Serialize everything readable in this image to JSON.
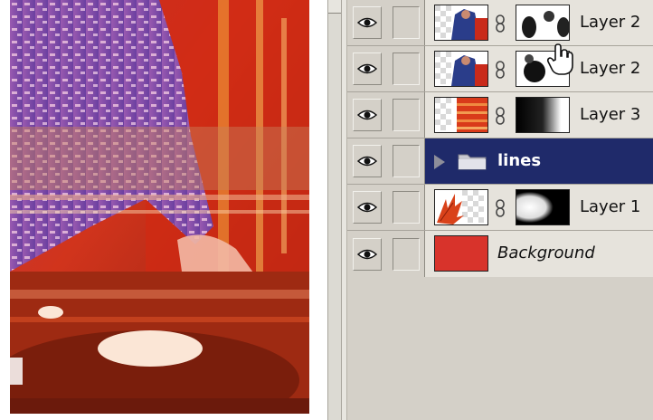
{
  "layers_panel": {
    "rows": [
      {
        "type": "layer",
        "name": "Layer 2",
        "visible": true,
        "has_mask": true,
        "thumb": "figure"
      },
      {
        "type": "layer",
        "name": "Layer 2",
        "visible": true,
        "has_mask": true,
        "thumb": "figure"
      },
      {
        "type": "layer",
        "name": "Layer 3",
        "visible": true,
        "has_mask": true,
        "thumb": "stripes"
      },
      {
        "type": "group",
        "name": "lines",
        "visible": true,
        "selected": true
      },
      {
        "type": "layer",
        "name": "Layer 1",
        "visible": true,
        "has_mask": true,
        "thumb": "leaf"
      },
      {
        "type": "layer",
        "name": "Background",
        "visible": true,
        "has_mask": false,
        "thumb": "red"
      }
    ]
  },
  "colors": {
    "selected_row": "#1f2a6a",
    "background_fill": "#d8332b",
    "panel_gray": "#d4d0c8"
  },
  "icons": {
    "visibility": "eye-icon",
    "link": "chain-link-icon",
    "group": "folder-icon",
    "expand": "triangle-right-icon",
    "pointer": "hand-cursor-icon"
  }
}
